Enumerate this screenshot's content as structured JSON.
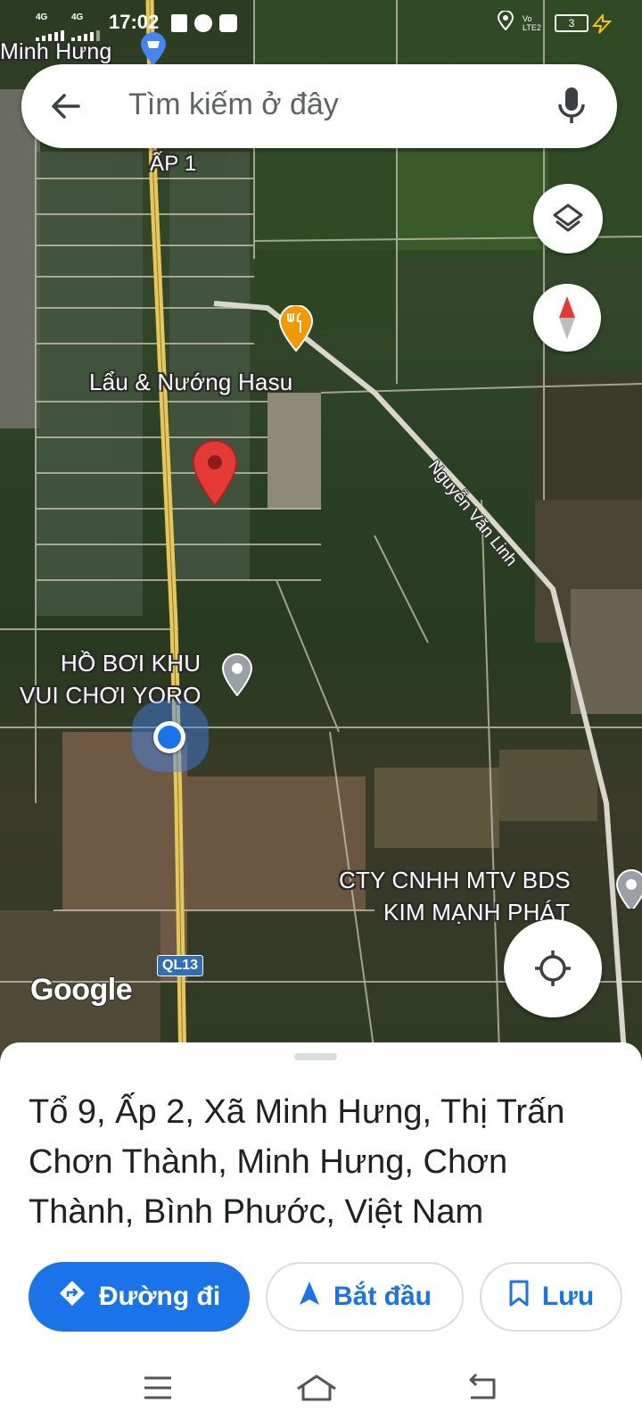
{
  "status_bar": {
    "net1": "4G",
    "net2": "4G",
    "time": "17:02",
    "volte": "Vo LTE2",
    "battery": "3"
  },
  "search": {
    "placeholder": "Tìm kiếm ở đây"
  },
  "map": {
    "labels": {
      "top_place": "Minh Hưng",
      "hamlet": "ẤP 1",
      "restaurant": "Lẩu & Nướng Hasu",
      "road": "Nguyễn Văn Linh",
      "pool_line1": "HỒ BƠI KHU",
      "pool_line2": "VUI CHƠI YORO",
      "company_line1": "CTY CNHH MTV BDS",
      "company_line2": "KIM MẠNH PHÁT",
      "highway": "QL13",
      "attribution": "Google"
    },
    "icons": [
      "layers-icon",
      "compass-icon",
      "my-location-icon",
      "restaurant-pin-icon",
      "red-location-pin-icon",
      "gray-place-pin-icon",
      "blue-dot-icon",
      "shopping-pin-icon"
    ],
    "colors": {
      "accent": "#1a73e8",
      "red_pin": "#e53935",
      "restaurant_pin": "#f29900",
      "main_road": "#e8c75a"
    }
  },
  "place_sheet": {
    "address": "Tổ 9, Ấp 2, Xã Minh Hưng, Thị Trấn Chơn Thành, Minh Hưng, Chơn Thành, Bình Phước, Việt Nam",
    "actions": {
      "directions": "Đường đi",
      "start": "Bắt đầu",
      "save": "Lưu"
    }
  }
}
